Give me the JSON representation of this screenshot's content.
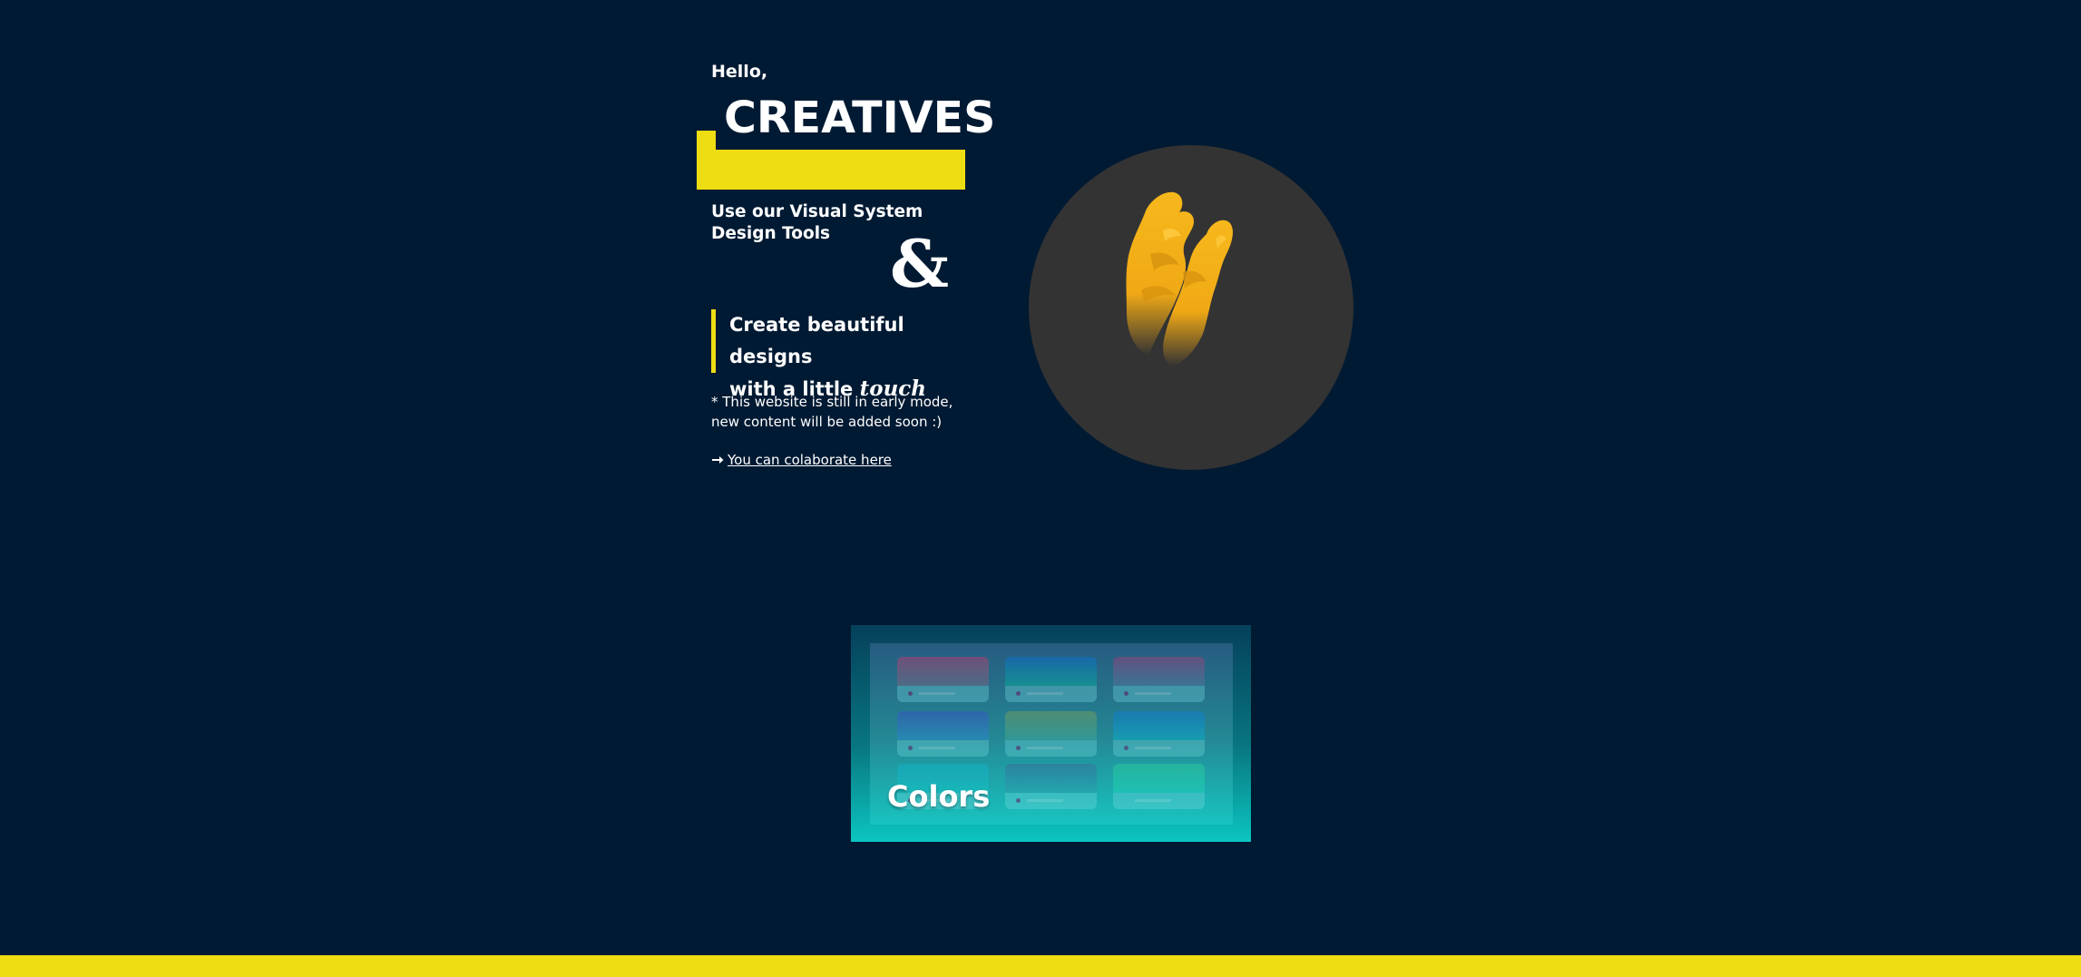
{
  "hero": {
    "greeting": "Hello,",
    "headline": "CREATIVES",
    "subtitle": "Use our Visual System Design Tools",
    "ampersand": "&",
    "quote_line1": "Create beautiful designs",
    "quote_line2_prefix": "with a little ",
    "quote_emphasis": "touch",
    "note": "* This website is still in early mode, new content will be added soon :)",
    "collab_link": "You can colaborate here"
  },
  "cards": [
    {
      "title": "Colors"
    }
  ],
  "colors": {
    "background": "#011a33",
    "accent_yellow": "#eedd12",
    "circle": "#333333",
    "hand": "#f5b21a",
    "card_teal": "#0cc5c0"
  },
  "icons": {
    "collab": "arrow-right-icon",
    "hero_image": "hands-illustration"
  }
}
